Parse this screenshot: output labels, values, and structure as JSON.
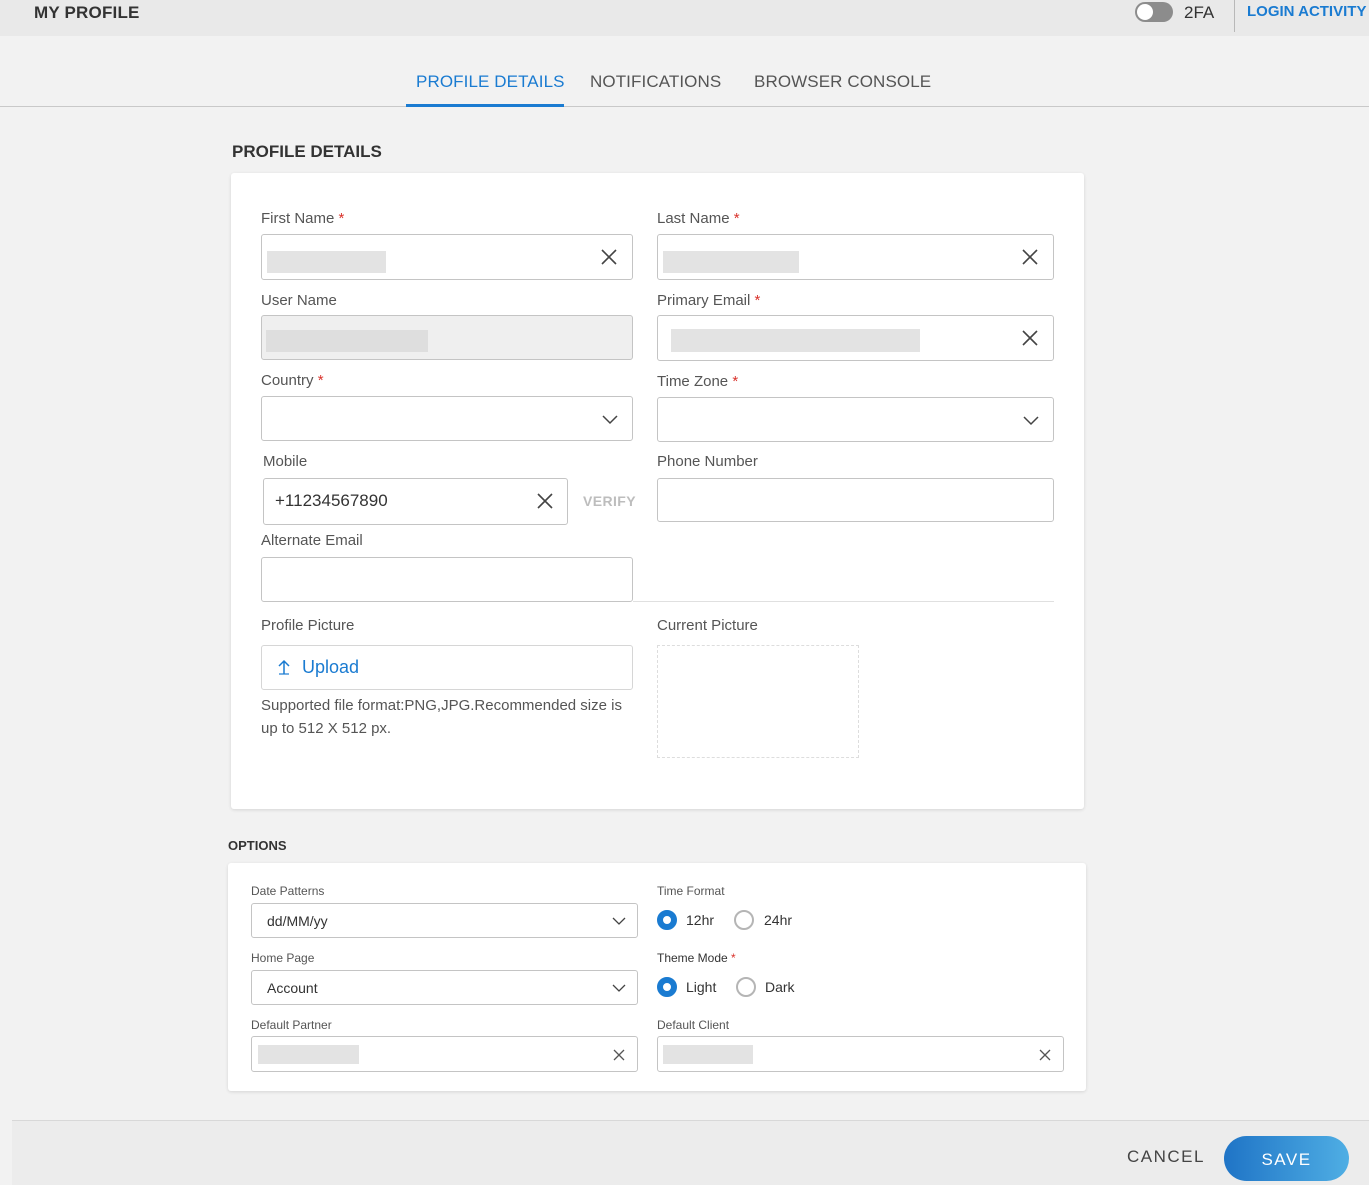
{
  "header": {
    "title": "MY PROFILE",
    "twofa_label": "2FA",
    "twofa_enabled": false,
    "login_activity": "LOGIN ACTIVITY"
  },
  "tabs": [
    {
      "label": "PROFILE DETAILS",
      "active": true
    },
    {
      "label": "NOTIFICATIONS",
      "active": false
    },
    {
      "label": "BROWSER CONSOLE",
      "active": false
    }
  ],
  "profile": {
    "section_title": "PROFILE DETAILS",
    "first_name": {
      "label": "First Name",
      "required": "*"
    },
    "last_name": {
      "label": "Last Name",
      "required": "*"
    },
    "user_name": {
      "label": "User Name"
    },
    "primary_email": {
      "label": "Primary Email",
      "required": "*"
    },
    "country": {
      "label": "Country",
      "required": "*",
      "value": ""
    },
    "time_zone": {
      "label": "Time Zone",
      "required": "*",
      "value": ""
    },
    "mobile": {
      "label": "Mobile",
      "value": "+11234567890",
      "verify": "VERIFY"
    },
    "phone_number": {
      "label": "Phone Number",
      "value": ""
    },
    "alternate_email": {
      "label": "Alternate Email",
      "value": ""
    },
    "profile_picture": {
      "label": "Profile Picture",
      "upload": "Upload",
      "help": "Supported file format:PNG,JPG.Recommended size is up to 512 X 512 px."
    },
    "current_picture": {
      "label": "Current Picture"
    }
  },
  "options": {
    "section_title": "OPTIONS",
    "date_patterns": {
      "label": "Date Patterns",
      "value": "dd/MM/yy"
    },
    "time_format": {
      "label": "Time Format",
      "options": [
        "12hr",
        "24hr"
      ],
      "selected": "12hr"
    },
    "home_page": {
      "label": "Home Page",
      "value": "Account"
    },
    "theme_mode": {
      "label": "Theme Mode",
      "required": "*",
      "options": [
        "Light",
        "Dark"
      ],
      "selected": "Light"
    },
    "default_partner": {
      "label": "Default Partner"
    },
    "default_client": {
      "label": "Default Client"
    }
  },
  "footer": {
    "cancel": "CANCEL",
    "save": "SAVE"
  },
  "colors": {
    "accent": "#1a7bd1",
    "required": "#d9322b"
  },
  "icons": [
    "clear-icon",
    "chevron-down-icon",
    "upload-arrow-icon"
  ]
}
